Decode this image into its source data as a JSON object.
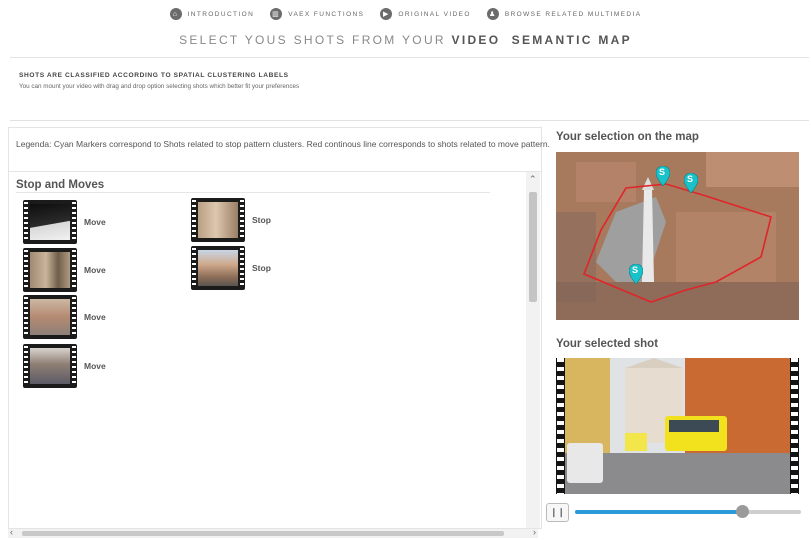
{
  "nav": {
    "items": [
      {
        "label": "INTRODUCTION",
        "icon": "home-icon"
      },
      {
        "label": "VAEX FUNCTIONS",
        "icon": "chart-icon"
      },
      {
        "label": "ORIGINAL VIDEO",
        "icon": "play-icon"
      },
      {
        "label": "BROWSE RELATED MULTIMEDIA",
        "icon": "people-icon"
      }
    ]
  },
  "title": {
    "prefix": "SELECT YOUS SHOTS FROM YOUR",
    "bold1": "VIDEO",
    "bold2": "SEMANTIC MAP"
  },
  "info": {
    "heading": "SHOTS ARE CLASSIFIED ACCORDING TO SPATIAL CLUSTERING LABELS",
    "subtext": "You can mount your video with drag and drop option selecting shots which better fit your preferences"
  },
  "legend": "Legenda: Cyan Markers correspond to Shots related to stop pattern clusters. Red continous line corresponds to shots related to move pattern.",
  "section_title": "Stop and Moves",
  "shots": [
    {
      "label": "Move",
      "thumb": "dark-street"
    },
    {
      "label": "Move",
      "thumb": "arcade"
    },
    {
      "label": "Move",
      "thumb": "square"
    },
    {
      "label": "Move",
      "thumb": "road"
    },
    {
      "label": "Stop",
      "thumb": "facade"
    },
    {
      "label": "Stop",
      "thumb": "piazza"
    }
  ],
  "right": {
    "map_title": "Your selection on the map",
    "map_marker_label": "S",
    "shot_title": "Your selected shot",
    "playback_progress": 0.74
  },
  "colors": {
    "accent": "#2a9bd8",
    "marker": "#19c2c9",
    "route": "#e0242a"
  }
}
